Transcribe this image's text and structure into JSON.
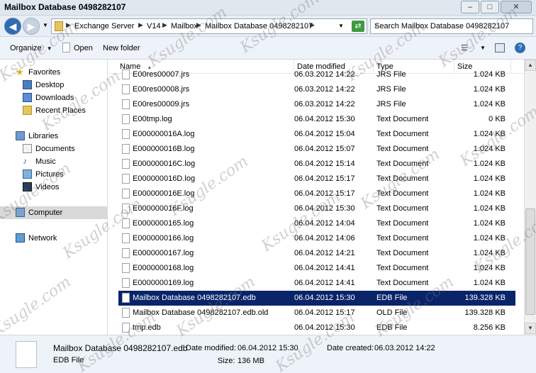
{
  "window": {
    "title": "Mailbox Database 0498282107",
    "min_label": "–",
    "max_label": "□",
    "close_label": "✕"
  },
  "address": {
    "crumbs": [
      "Exchange Server",
      "V14",
      "Mailbox",
      "Mailbox Database 0498282107"
    ],
    "search_placeholder": "Search Mailbox Database 0498282107"
  },
  "toolbar": {
    "organize_label": "Organize",
    "open_label": "Open",
    "new_folder_label": "New folder"
  },
  "sidebar": {
    "favorites": {
      "label": "Favorites",
      "items": [
        "Desktop",
        "Downloads",
        "Recent Places"
      ]
    },
    "libraries": {
      "label": "Libraries",
      "items": [
        "Documents",
        "Music",
        "Pictures",
        "Videos"
      ]
    },
    "computer_label": "Computer",
    "network_label": "Network"
  },
  "columns": [
    "Name",
    "Date modified",
    "Type",
    "Size"
  ],
  "files": [
    {
      "name": "E00res00007.jrs",
      "date": "06.03.2012 14:22",
      "type": "JRS File",
      "size": "1.024 KB"
    },
    {
      "name": "E00res00008.jrs",
      "date": "06.03.2012 14:22",
      "type": "JRS File",
      "size": "1.024 KB"
    },
    {
      "name": "E00res00009.jrs",
      "date": "06.03.2012 14:22",
      "type": "JRS File",
      "size": "1.024 KB"
    },
    {
      "name": "E00tmp.log",
      "date": "06.04.2012 15:30",
      "type": "Text Document",
      "size": "0 KB"
    },
    {
      "name": "E000000016A.log",
      "date": "06.04.2012 15:04",
      "type": "Text Document",
      "size": "1.024 KB"
    },
    {
      "name": "E000000016B.log",
      "date": "06.04.2012 15:07",
      "type": "Text Document",
      "size": "1.024 KB"
    },
    {
      "name": "E000000016C.log",
      "date": "06.04.2012 15:14",
      "type": "Text Document",
      "size": "1.024 KB"
    },
    {
      "name": "E000000016D.log",
      "date": "06.04.2012 15:17",
      "type": "Text Document",
      "size": "1.024 KB"
    },
    {
      "name": "E000000016E.log",
      "date": "06.04.2012 15:17",
      "type": "Text Document",
      "size": "1.024 KB"
    },
    {
      "name": "E000000016F.log",
      "date": "06.04.2012 15:30",
      "type": "Text Document",
      "size": "1.024 KB"
    },
    {
      "name": "E0000000165.log",
      "date": "06.04.2012 14:04",
      "type": "Text Document",
      "size": "1.024 KB"
    },
    {
      "name": "E0000000166.log",
      "date": "06.04.2012 14:06",
      "type": "Text Document",
      "size": "1.024 KB"
    },
    {
      "name": "E0000000167.log",
      "date": "06.04.2012 14:21",
      "type": "Text Document",
      "size": "1.024 KB"
    },
    {
      "name": "E0000000168.log",
      "date": "06.04.2012 14:41",
      "type": "Text Document",
      "size": "1.024 KB"
    },
    {
      "name": "E0000000169.log",
      "date": "06.04.2012 14:41",
      "type": "Text Document",
      "size": "1.024 KB"
    },
    {
      "name": "Mailbox Database 0498282107.edb",
      "date": "06.04.2012 15:30",
      "type": "EDB File",
      "size": "139.328 KB",
      "selected": true
    },
    {
      "name": "Mailbox Database 0498282107.edb.old",
      "date": "06.04.2012 15:17",
      "type": "OLD File",
      "size": "139.328 KB"
    },
    {
      "name": "tmp.edb",
      "date": "06.04.2012 15:30",
      "type": "EDB File",
      "size": "8.256 KB"
    }
  ],
  "details": {
    "filename": "Mailbox Database 0498282107.edb",
    "filetype": "EDB File",
    "date_modified_label": "Date modified:",
    "date_modified": "06.04.2012 15:30",
    "date_created_label": "Date created:",
    "date_created": "06.03.2012 14:22",
    "size_label": "Size:",
    "size": "136 MB"
  },
  "watermark": "Ksugle.com",
  "colors": {
    "selection": "#0a246a",
    "chrome": "#e8eef5"
  }
}
